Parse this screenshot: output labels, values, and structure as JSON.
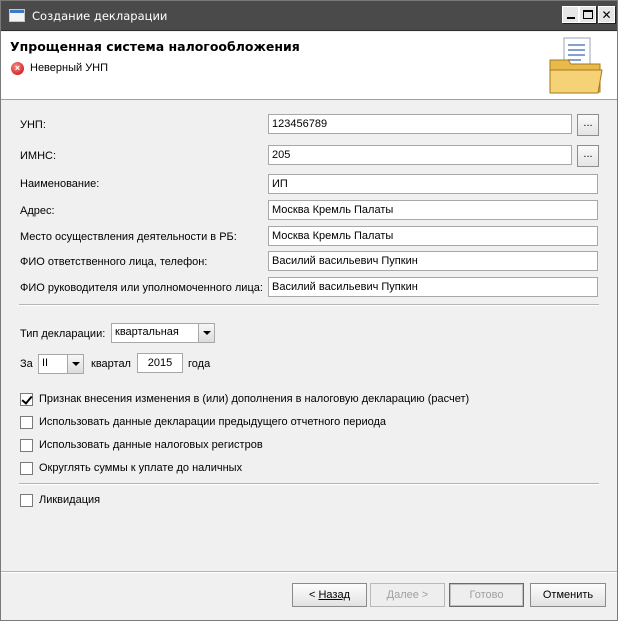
{
  "window": {
    "title": "Создание декларации",
    "minimize": "",
    "maximize": "",
    "close": "✕"
  },
  "header": {
    "heading": "Упрощенная система налогообложения",
    "error_icon": "error-icon",
    "error_text": "Неверный УНП",
    "folder_icon": "folder-document-icon"
  },
  "fields": {
    "unp": {
      "label": "УНП:",
      "value": "123456789",
      "button": "..."
    },
    "imns": {
      "label": "ИМНС:",
      "value": "205",
      "button": "..."
    },
    "name": {
      "label": "Наименование:",
      "value": "ИП"
    },
    "address": {
      "label": "Адрес:",
      "value": "Москва Кремль Палаты"
    },
    "place": {
      "label": "Место осуществления деятельности в РБ:",
      "value": "Москва Кремль Палаты"
    },
    "responsible": {
      "label": "ФИО ответственного лица, телефон:",
      "value": "Василий васильевич Пупкин"
    },
    "head": {
      "label": "ФИО руководителя или уполномоченного лица:",
      "value": "Василий васильевич Пупкин"
    }
  },
  "declaration": {
    "type_label": "Тип декларации:",
    "type_value": "квартальная",
    "for_label": "За",
    "quarter_value": "II",
    "quarter_label": "квартал",
    "year_value": "2015",
    "year_label": "года"
  },
  "options": [
    {
      "label": "Признак внесения изменения в (или) дополнения в налоговую декларацию (расчет)",
      "checked": true
    },
    {
      "label": "Использовать данные декларации предыдущего отчетного периода",
      "checked": false
    },
    {
      "label": "Использовать данные налоговых регистров",
      "checked": false
    },
    {
      "label": "Округлять суммы к уплате до наличных",
      "checked": false
    }
  ],
  "liquidation": {
    "label": "Ликвидация",
    "checked": false
  },
  "buttons": {
    "back_arrow": "<",
    "back": "Назад",
    "next": "Далее",
    "next_arrow": ">",
    "finish": "Готово",
    "cancel": "Отменить"
  }
}
